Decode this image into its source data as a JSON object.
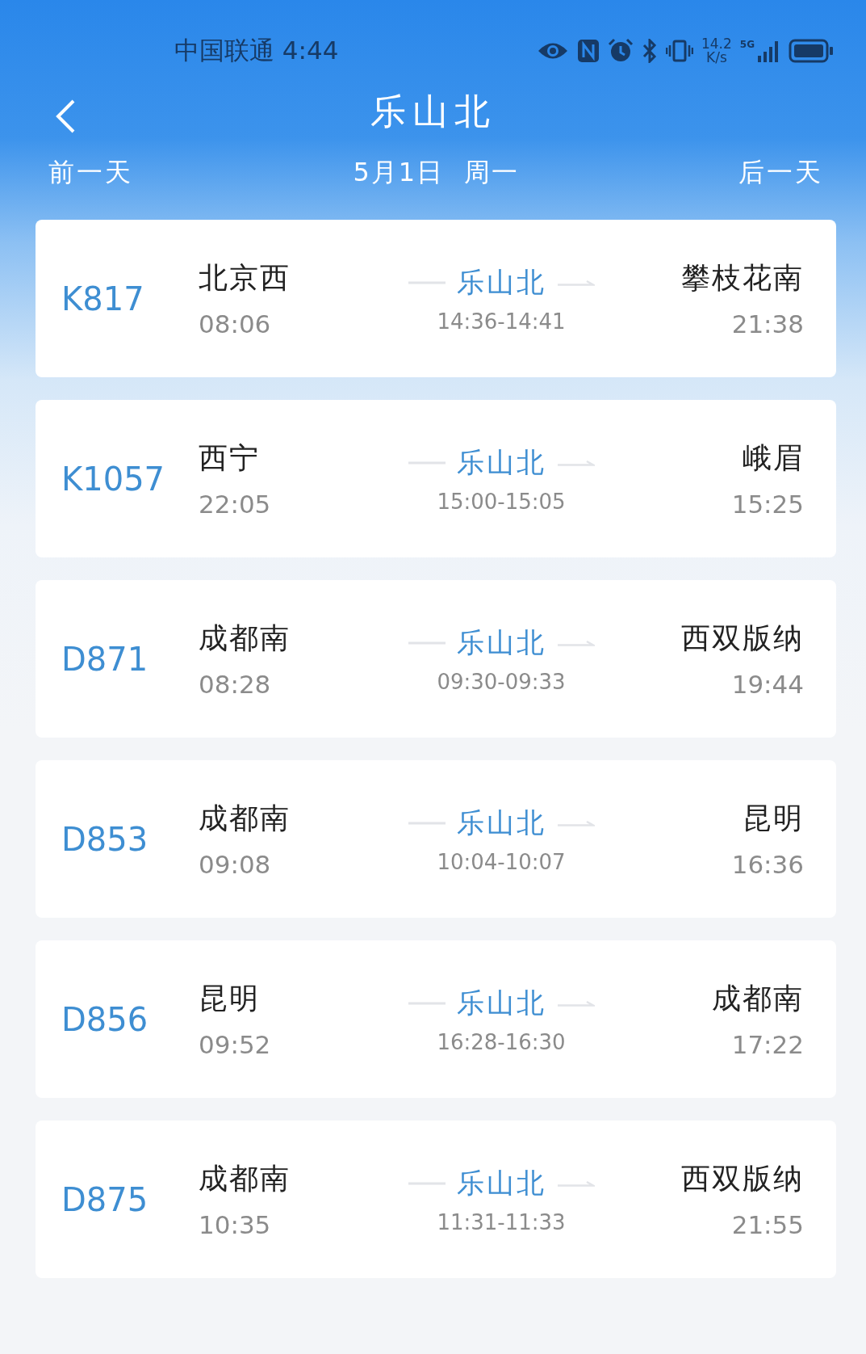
{
  "status_bar": {
    "carrier_time": "中国联通 4:44",
    "net_speed": [
      "14.2",
      "K/s"
    ],
    "network": "5G"
  },
  "header": {
    "title": "乐山北",
    "prev_day": "前一天",
    "date": "5月1日  周一",
    "next_day": "后一天"
  },
  "trains": [
    {
      "number": "K817",
      "from": "北京西",
      "depart": "08:06",
      "station": "乐山北",
      "stop_time": "14:36-14:41",
      "to": "攀枝花南",
      "arrive": "21:38"
    },
    {
      "number": "K1057",
      "from": "西宁",
      "depart": "22:05",
      "station": "乐山北",
      "stop_time": "15:00-15:05",
      "to": "峨眉",
      "arrive": "15:25"
    },
    {
      "number": "D871",
      "from": "成都南",
      "depart": "08:28",
      "station": "乐山北",
      "stop_time": "09:30-09:33",
      "to": "西双版纳",
      "arrive": "19:44"
    },
    {
      "number": "D853",
      "from": "成都南",
      "depart": "09:08",
      "station": "乐山北",
      "stop_time": "10:04-10:07",
      "to": "昆明",
      "arrive": "16:36"
    },
    {
      "number": "D856",
      "from": "昆明",
      "depart": "09:52",
      "station": "乐山北",
      "stop_time": "16:28-16:30",
      "to": "成都南",
      "arrive": "17:22"
    },
    {
      "number": "D875",
      "from": "成都南",
      "depart": "10:35",
      "station": "乐山北",
      "stop_time": "11:31-11:33",
      "to": "西双版纳",
      "arrive": "21:55"
    }
  ]
}
